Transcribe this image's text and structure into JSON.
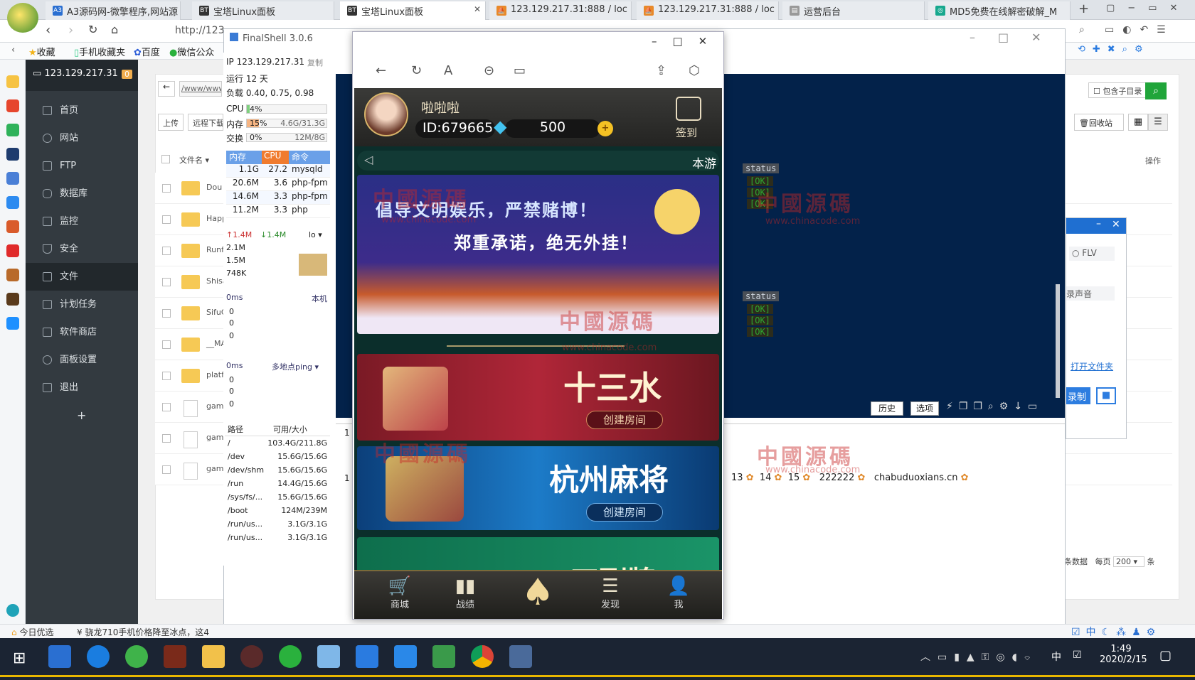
{
  "browser": {
    "tabs": [
      {
        "label": "A3源码网-微擎程序,网站源",
        "icon": "A3"
      },
      {
        "label": "宝塔Linux面板",
        "icon": "BT"
      },
      {
        "label": "宝塔Linux面板",
        "icon": "BT"
      },
      {
        "label": "123.129.217.31:888 / loc",
        "icon": "pma"
      },
      {
        "label": "123.129.217.31:888 / loc",
        "icon": "pma"
      },
      {
        "label": "运营后台",
        "icon": "doc"
      },
      {
        "label": "MD5免费在线解密破解_M",
        "icon": "md5"
      }
    ],
    "address": "http://123",
    "favorites": [
      "收藏",
      "手机收藏夹",
      "百度",
      "微信公众"
    ]
  },
  "bt": {
    "server_ip": "123.129.217.31",
    "badge": "0",
    "menu": [
      "首页",
      "网站",
      "FTP",
      "数据库",
      "监控",
      "安全",
      "文件",
      "计划任务",
      "软件商店",
      "面板设置",
      "退出"
    ],
    "add": "+",
    "path_input": "/www/www",
    "buttons": {
      "upload": "上传",
      "remote": "远程下载",
      "recycle": "回收站",
      "include_sub": "包含子目录"
    },
    "table_header": {
      "name": "文件名",
      "ops": "操作"
    },
    "files": [
      "Dou",
      "Happ",
      "Runf",
      "Shisa",
      "SifuC",
      "__MA",
      "platf",
      "gam",
      "gam",
      "gam"
    ],
    "pager": {
      "total_label": "条数据",
      "per_page": "每页",
      "per_value": "200",
      "unit": "条"
    }
  },
  "finalshell": {
    "title": "FinalShell 3.0.6",
    "ip": "IP 123.129.217.31",
    "copy": "复制",
    "uptime": "运行 12 天",
    "load": "负载 0.40, 0.75, 0.98",
    "cpu": {
      "label": "CPU",
      "value": "4%",
      "pct": 0.04
    },
    "mem": {
      "label": "内存",
      "value": "15%",
      "size": "4.6G/31.3G",
      "pct": 0.15
    },
    "swap": {
      "label": "交换",
      "value": "0%",
      "size": "12M/8G",
      "pct": 0.0
    },
    "proc_header": [
      "内存",
      "CPU",
      "命令"
    ],
    "procs": [
      {
        "mem": "1.1G",
        "cpu": "27.2",
        "cmd": "mysqld"
      },
      {
        "mem": "20.6M",
        "cpu": "3.6",
        "cmd": "php-fpm"
      },
      {
        "mem": "14.6M",
        "cpu": "3.3",
        "cmd": "php-fpm"
      },
      {
        "mem": "11.2M",
        "cpu": "3.3",
        "cmd": "php"
      }
    ],
    "net": {
      "up": "1.4M",
      "down": "1.4M",
      "iface": "lo",
      "levels": [
        "2.1M",
        "1.5M",
        "748K"
      ]
    },
    "ping1": {
      "ms": "0ms",
      "target": "本机",
      "vals": [
        "0",
        "0",
        "0"
      ]
    },
    "ping2": {
      "ms": "0ms",
      "target": "多地点ping",
      "vals": [
        "0",
        "0",
        "0"
      ]
    },
    "disk_header": [
      "路径",
      "可用/大小"
    ],
    "disks": [
      {
        "path": "/",
        "size": "103.4G/211.8G"
      },
      {
        "path": "/dev",
        "size": "15.6G/15.6G"
      },
      {
        "path": "/dev/shm",
        "size": "15.6G/15.6G"
      },
      {
        "path": "/run",
        "size": "14.4G/15.6G"
      },
      {
        "path": "/sys/fs/...",
        "size": "15.6G/15.6G"
      },
      {
        "path": "/boot",
        "size": "124M/239M"
      },
      {
        "path": "/run/us...",
        "size": "3.1G/3.1G"
      },
      {
        "path": "/run/us...",
        "size": "3.1G/3.1G"
      }
    ],
    "terminal_buttons": {
      "history": "历史",
      "options": "选项"
    },
    "status_col": "status",
    "ok": "[OK]",
    "tab_number": "1",
    "row_values": [
      "13",
      "14",
      "15",
      "222222",
      "chabuduoxians.cn"
    ]
  },
  "dialog": {
    "flv": "FLV",
    "audio": "录声音",
    "open_folder": "打开文件夹",
    "record": "录制"
  },
  "game": {
    "nickname": "啦啦啦",
    "id": "ID:679665",
    "diamonds": "500",
    "sign_in": "签到",
    "notice": "本游",
    "slogan1": "倡导文明娱乐，严禁赌博！",
    "slogan2": "郑重承诺，绝无外挂！",
    "game1": "十三水",
    "game2": "杭州麻将",
    "game3": "四副牌",
    "create_room": "创建房间",
    "nav": [
      "商城",
      "战绩",
      "发现",
      "我"
    ]
  },
  "watermark": {
    "text": "中國源碼",
    "url": "www.chinacode.com"
  },
  "statusbar": {
    "left": "今日优选",
    "news": "骁龙710手机价格降至冰点，这4"
  },
  "taskbar": {
    "time": "1:49",
    "date": "2020/2/15",
    "ime": "中"
  },
  "colors": {
    "terminal_bg": "#03224a",
    "bt_sidebar": "#333a40",
    "bt_green": "#20a53a"
  }
}
